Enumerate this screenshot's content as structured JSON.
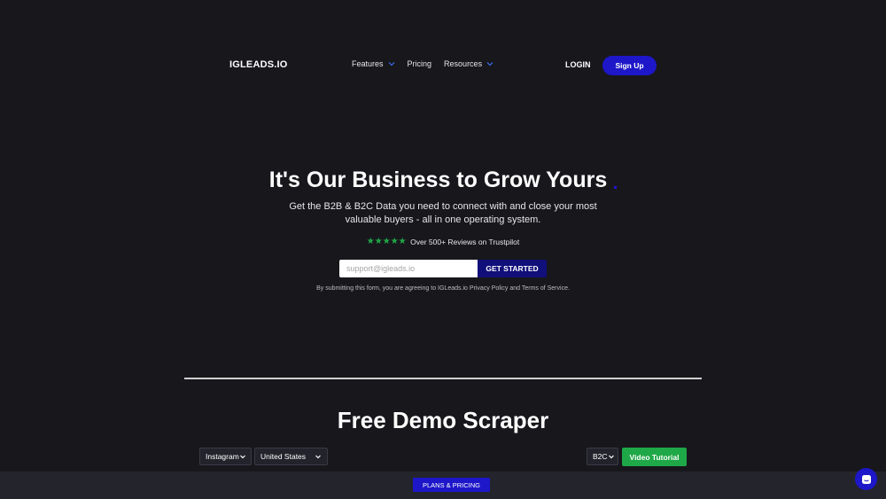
{
  "nav": {
    "logo": "IGLEADS.IO",
    "items": [
      {
        "label": "Features",
        "has_dropdown": true
      },
      {
        "label": "Pricing",
        "has_dropdown": false
      },
      {
        "label": "Resources",
        "has_dropdown": true
      }
    ],
    "login": "LOGIN",
    "signup": "Sign Up"
  },
  "hero": {
    "title": "It's Our Business to Grow Yours",
    "subtitle": "Get the B2B & B2C Data you need to connect with and close your most valuable buyers - all in one operating system.",
    "stars": "★★★★★",
    "reviews": "Over 500+ Reviews on Trustpilot",
    "email_placeholder": "support@igleads.io",
    "cta": "GET STARTED",
    "disclaimer": "By submitting this form, you are agreeing to IGLeads.io Privacy Policy and Terms of Service."
  },
  "demo": {
    "title": "Free Demo Scraper",
    "platform": "Instagram",
    "country": "United States",
    "type": "B2C",
    "video_button": "Video Tutorial"
  },
  "bottom": {
    "plans_button": "PLANS & PRICING"
  },
  "colors": {
    "background": "#18171c",
    "accent": "#1d17c9",
    "cta_dark": "#110f7a",
    "green": "#1fa847"
  },
  "icons": [
    "chevron-down-icon",
    "star-icon",
    "chat-icon"
  ]
}
